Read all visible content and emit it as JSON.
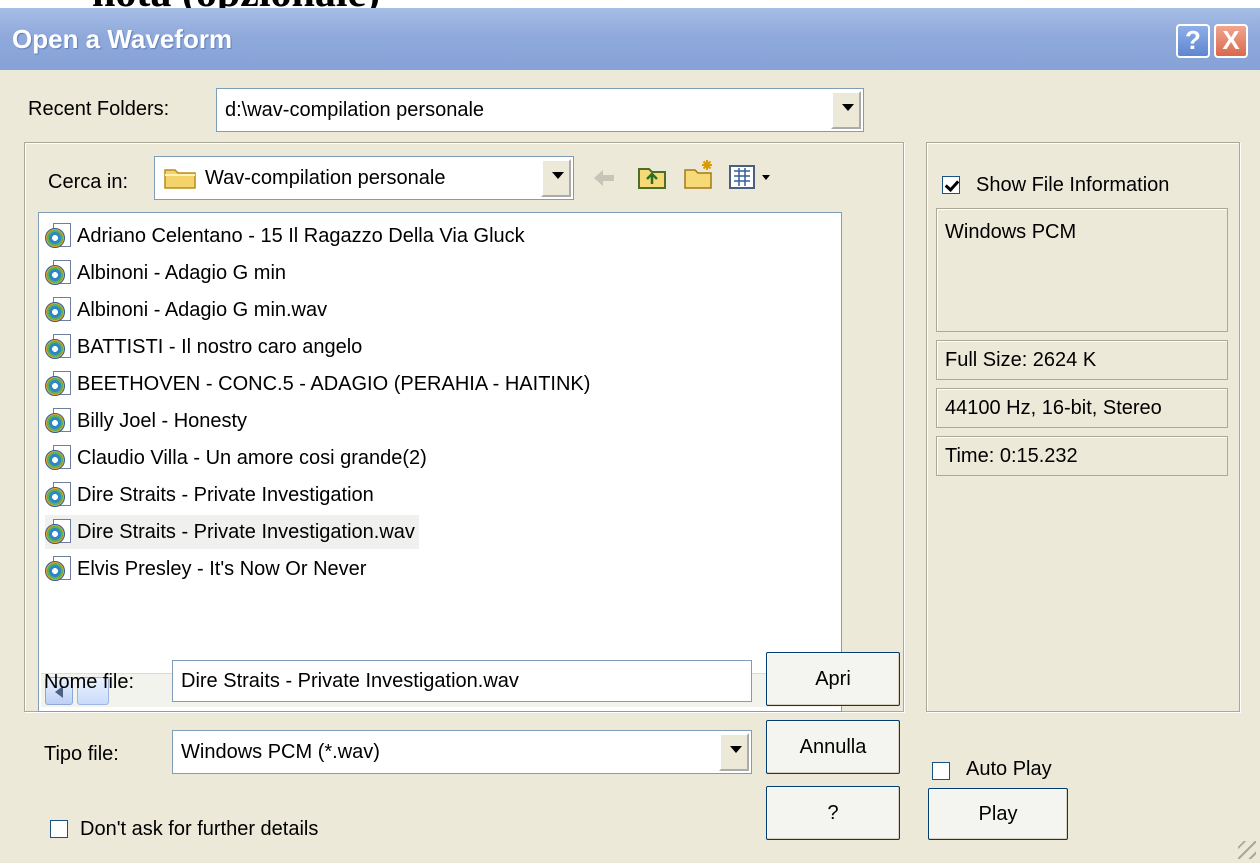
{
  "window": {
    "title": "Open a Waveform",
    "clipped_heading": "nota (opzionale)",
    "help_label": "?",
    "close_label": "X"
  },
  "recent_folders": {
    "label": "Recent Folders:",
    "value": "d:\\wav-compilation personale"
  },
  "lookin": {
    "label": "Cerca in:",
    "value": "Wav-compilation personale",
    "toolbar_icons": [
      "back-arrow-icon",
      "up-folder-icon",
      "new-folder-icon",
      "view-menu-icon"
    ]
  },
  "files": [
    {
      "name": "Adriano Celentano - 15 Il Ragazzo Della Via Gluck",
      "selected": false
    },
    {
      "name": "Albinoni - Adagio G min",
      "selected": false
    },
    {
      "name": "Albinoni - Adagio G min.wav",
      "selected": false
    },
    {
      "name": "BATTISTI - Il nostro caro angelo",
      "selected": false
    },
    {
      "name": "BEETHOVEN - CONC.5 - ADAGIO (PERAHIA - HAITINK)",
      "selected": false
    },
    {
      "name": "Billy Joel - Honesty",
      "selected": false
    },
    {
      "name": "Claudio Villa - Un amore cosi grande(2)",
      "selected": false
    },
    {
      "name": "Dire Straits - Private Investigation",
      "selected": false
    },
    {
      "name": "Dire Straits - Private Investigation.wav",
      "selected": true
    },
    {
      "name": "Elvis Presley - It's Now Or Never",
      "selected": false
    }
  ],
  "filename": {
    "label": "Nome file:",
    "value": "Dire Straits - Private Investigation.wav"
  },
  "filetype": {
    "label": "Tipo file:",
    "value": "Windows PCM (*.wav)"
  },
  "buttons": {
    "open": "Apri",
    "cancel": "Annulla",
    "help": "?",
    "play": "Play"
  },
  "options": {
    "dont_ask": "Don't ask for further details",
    "show_info": "Show File Information",
    "auto_play": "Auto Play",
    "show_info_checked": true,
    "dont_ask_checked": false,
    "auto_play_checked": false
  },
  "file_info": {
    "format": "Windows PCM",
    "full_size": "Full Size: 2624 K",
    "properties": "44100 Hz, 16-bit, Stereo",
    "time": "Time:  0:15.232"
  },
  "colors": {
    "titlebar": "#8fa9db",
    "dialog": "#ece9d8",
    "field_border": "#7f9db9"
  }
}
